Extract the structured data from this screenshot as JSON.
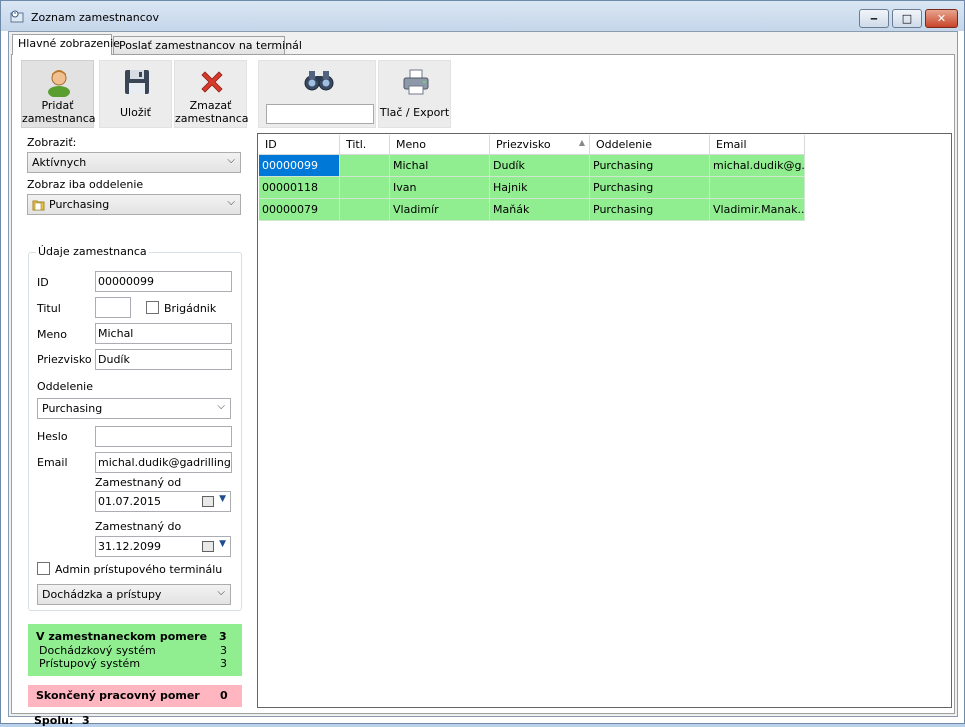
{
  "window": {
    "title": "Zoznam zamestnancov",
    "minimize_glyph": "‒",
    "maximize_glyph": "□",
    "close_glyph": "✕"
  },
  "tabs": [
    {
      "label": "Hlavné zobrazenie",
      "active": true
    },
    {
      "label": "Poslať zamestnancov na terminál",
      "active": false
    }
  ],
  "toolbar": {
    "add_label_1": "Pridať",
    "add_label_2": "zamestnanca",
    "save_label": "Uložiť",
    "delete_label_1": "Zmazať",
    "delete_label_2": "zamestnanca",
    "search_value": "",
    "print_label": "Tlač / Export"
  },
  "filters": {
    "show_label": "Zobraziť:",
    "show_value": "Aktívnych",
    "dept_label": "Zobraz iba oddelenie",
    "dept_value": "Purchasing"
  },
  "employee": {
    "group_label": "Údaje zamestnanca",
    "id_label": "ID",
    "id_value": "00000099",
    "title_label": "Titul",
    "title_value": "",
    "brigadnik_label": "Brigádnik",
    "name_label": "Meno",
    "name_value": "Michal",
    "surname_label": "Priezvisko",
    "surname_value": "Dudík",
    "dept_label": "Oddelenie",
    "dept_value": "Purchasing",
    "password_label": "Heslo",
    "password_value": "",
    "email_label": "Email",
    "email_value": "michal.dudik@gadrilling.com",
    "from_label": "Zamestnaný od",
    "from_value": "01.07.2015",
    "to_label": "Zamestnaný do",
    "to_value": "31.12.2099",
    "admin_label": "Admin prístupového terminálu",
    "access_value": "Dochádzka a prístupy"
  },
  "summary": {
    "employed_label": "V zamestnaneckom pomere",
    "employed_count": "3",
    "attendance_label": "Dochádzkový systém",
    "attendance_count": "3",
    "access_label": "Prístupový systém",
    "access_count": "3",
    "ended_label": "Skončený pracovný pomer",
    "ended_count": "0",
    "total_label": "Spolu:",
    "total_count": "3"
  },
  "table": {
    "columns": [
      "ID",
      "Titl.",
      "Meno",
      "Priezvisko",
      "Oddelenie",
      "Email"
    ],
    "sort_indicator": "▲",
    "rows": [
      [
        "00000099",
        "",
        "Michal",
        "Dudík",
        "Purchasing",
        "michal.dudik@g..."
      ],
      [
        "00000118",
        "",
        "Ivan",
        "Hajnik",
        "Purchasing",
        ""
      ],
      [
        "00000079",
        "",
        "Vladimír",
        "Maňák",
        "Purchasing",
        "Vladimir.Manak..."
      ]
    ]
  },
  "colors": {
    "row_active": "#90ee90",
    "selected_cell": "#0078d7",
    "ended_bg": "#ffb6c1"
  },
  "icons": [
    "app-icon",
    "user-add-icon",
    "save-disk-icon",
    "delete-x-icon",
    "binoculars-icon",
    "printer-icon",
    "folder-icon",
    "calendar-icon"
  ]
}
